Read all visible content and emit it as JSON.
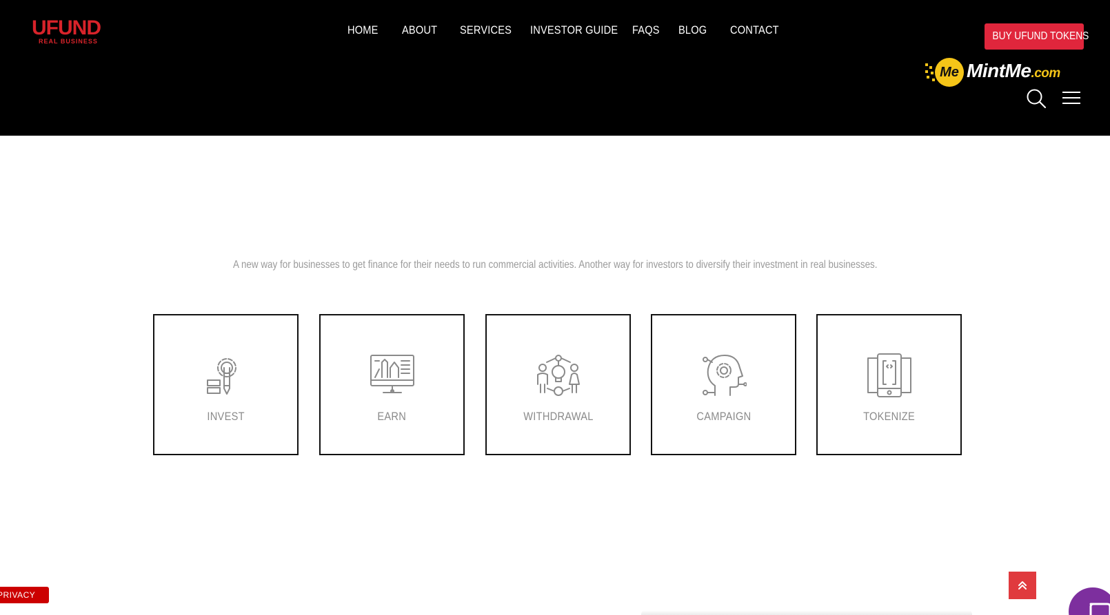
{
  "brand": {
    "logo_main": "UFUND",
    "logo_sub": "REAL BUSINESS",
    "accent_color": "#d8232a"
  },
  "nav": {
    "items": [
      {
        "label": "HOME"
      },
      {
        "label": "ABOUT"
      },
      {
        "label": "SERVICES"
      },
      {
        "label": "INVESTOR GUIDE"
      },
      {
        "label": "FAQS"
      },
      {
        "label": "BLOG"
      },
      {
        "label": "CONTACT"
      }
    ]
  },
  "header": {
    "buy_button_label": "BUY UFUND TOKENS",
    "buy_button_color": "#e0263c",
    "partner_logo": {
      "badge": "Me",
      "name": "MintMe",
      "domain": ".com",
      "color": "#f5c518"
    },
    "search_icon": "search-icon",
    "menu_icon": "hamburger-menu-icon"
  },
  "main": {
    "tagline": "A new way for businesses to get finance for their needs to run commercial activities. Another way for investors to diversify their investment in real businesses.",
    "features": [
      {
        "label": "INVEST",
        "icon": "gear-pencil-icon"
      },
      {
        "label": "EARN",
        "icon": "monitor-design-icon"
      },
      {
        "label": "WITHDRAWAL",
        "icon": "people-idea-icon"
      },
      {
        "label": "CAMPAIGN",
        "icon": "head-gear-icon"
      },
      {
        "label": "TOKENIZE",
        "icon": "mobile-code-icon"
      }
    ]
  },
  "footer_widgets": {
    "privacy_label": "PRIVACY",
    "scroll_top_icon": "double-chevron-up-icon",
    "chat_icon": "chat-icon",
    "chat_color": "#7d2f9e"
  }
}
